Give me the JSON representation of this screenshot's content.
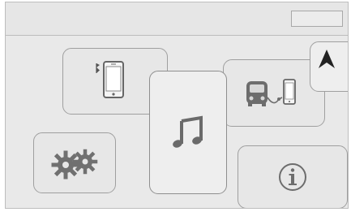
{
  "app": {
    "name": "infotainment-home-menu"
  },
  "colors": {
    "background": "#e9e9e9",
    "tile_border": "#9f9f9f",
    "icon": "#666666",
    "icon_dark": "#222222"
  },
  "header": {
    "status_indicator": ""
  },
  "tiles": [
    {
      "id": "telephone",
      "icons": [
        "bluetooth-icon",
        "smartphone-icon"
      ]
    },
    {
      "id": "music",
      "icons": [
        "music-note-icon"
      ]
    },
    {
      "id": "connected-apps",
      "icons": [
        "car-icon",
        "smartphone-icon"
      ]
    },
    {
      "id": "navigation",
      "icons": [
        "navigation-arrow-icon"
      ]
    },
    {
      "id": "settings",
      "icons": [
        "gears-icon"
      ]
    },
    {
      "id": "information",
      "icons": [
        "info-icon"
      ]
    }
  ]
}
